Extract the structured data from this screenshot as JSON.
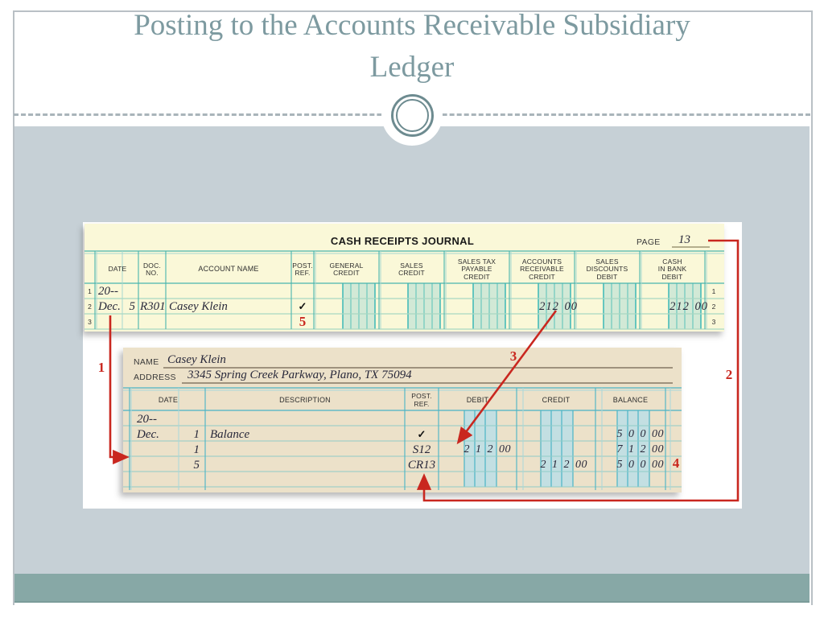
{
  "title": {
    "line1": "Posting to the Accounts Receivable Subsidiary",
    "line2": "Ledger"
  },
  "journal": {
    "title": "CASH RECEIPTS JOURNAL",
    "page_label": "PAGE",
    "page_number": "13",
    "columns": {
      "date": "DATE",
      "doc_no": "DOC.\nNO.",
      "account_name": "ACCOUNT NAME",
      "post_ref": "POST.\nREF.",
      "general_credit": "GENERAL\nCREDIT",
      "sales_credit": "SALES\nCREDIT",
      "sales_tax_payable_credit": "SALES TAX\nPAYABLE\nCREDIT",
      "accounts_receivable_credit": "ACCOUNTS\nRECEIVABLE\nCREDIT",
      "sales_discounts_debit": "SALES\nDISCOUNTS\nDEBIT",
      "cash_in_bank_debit": "CASH\nIN BANK\nDEBIT"
    },
    "row_numbers": [
      "1",
      "2",
      "3"
    ],
    "rows": {
      "r1": {
        "date": "20--"
      },
      "r2": {
        "month": "Dec.",
        "day": "5",
        "doc_no": "R301",
        "account": "Casey Klein",
        "post_ref": "✓",
        "accounts_receivable_credit": "212 00",
        "cash_in_bank_debit": "212 00"
      },
      "r3": {
        "post_ref_step": "5"
      }
    }
  },
  "ledger": {
    "name_label": "NAME",
    "name": "Casey Klein",
    "address_label": "ADDRESS",
    "address": "3345 Spring Creek Parkway, Plano, TX 75094",
    "columns": {
      "date": "DATE",
      "description": "DESCRIPTION",
      "post_ref": "POST.\nREF.",
      "debit": "DEBIT",
      "credit": "CREDIT",
      "balance": "BALANCE"
    },
    "rows": {
      "r1": {
        "date": "20--"
      },
      "r2": {
        "month": "Dec.",
        "day": "1",
        "description": "Balance",
        "post_ref": "✓",
        "balance": "5 0 0 00"
      },
      "r3": {
        "day": "1",
        "post_ref": "S12",
        "debit": "2 1 2 00",
        "balance": "7 1 2 00"
      },
      "r4": {
        "day": "5",
        "post_ref": "CR13",
        "credit": "2 1 2 00",
        "balance": "5 0 0 00"
      }
    }
  },
  "steps": {
    "s1": "1",
    "s2": "2",
    "s3": "3",
    "s4": "4",
    "s5": "5"
  },
  "colors": {
    "accent_red": "#c9271f",
    "title_teal": "#7d9aa0",
    "journal_paper": "#faf8d8",
    "ledger_paper": "#ece1c9",
    "body_gray": "#c6d0d6",
    "bottom_band_teal": "#87a8a6"
  }
}
